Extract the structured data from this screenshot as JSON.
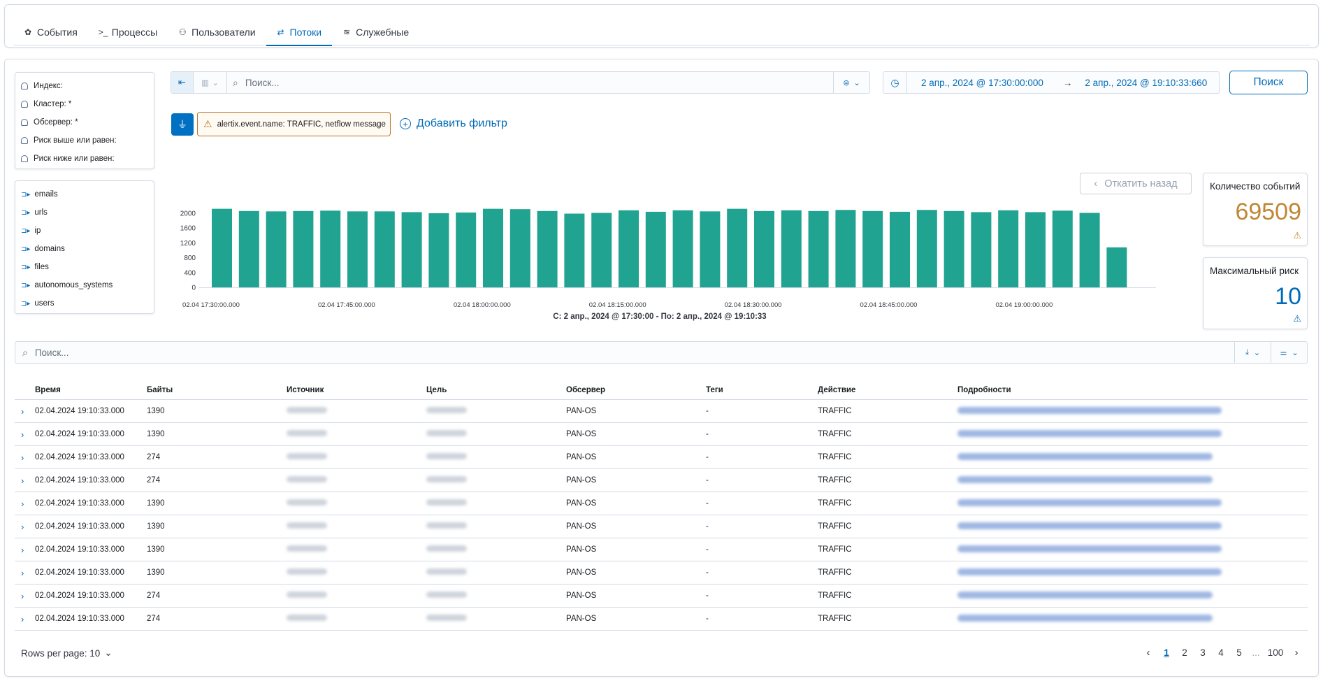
{
  "tabs": [
    {
      "label": "События",
      "icon": "events-icon",
      "glyph": "✿"
    },
    {
      "label": "Процессы",
      "icon": "terminal-icon",
      "glyph": ">_"
    },
    {
      "label": "Пользователи",
      "icon": "users-icon",
      "glyph": "⚇"
    },
    {
      "label": "Потоки",
      "icon": "flows-icon",
      "glyph": "⇄"
    },
    {
      "label": "Служебные",
      "icon": "layers-icon",
      "glyph": "≋"
    }
  ],
  "active_tab": "Потоки",
  "sidebar": {
    "filters": [
      {
        "label": "Индекс:"
      },
      {
        "label": "Кластер: *"
      },
      {
        "label": "Обсервер: *"
      },
      {
        "label": "Риск выше или равен:"
      },
      {
        "label": "Риск ниже или равен:"
      }
    ],
    "fields": [
      {
        "label": "emails"
      },
      {
        "label": "urls"
      },
      {
        "label": "ip"
      },
      {
        "label": "domains"
      },
      {
        "label": "files"
      },
      {
        "label": "autonomous_systems"
      },
      {
        "label": "users"
      }
    ]
  },
  "query": {
    "placeholder": "Поиск...",
    "search_button": "Поиск"
  },
  "date_range": {
    "start": "2 апр., 2024 @ 17:30:00:000",
    "arrow": "→",
    "end": "2 апр., 2024 @ 19:10:33:660"
  },
  "filters": {
    "pill_label": "alertix.event.name: TRAFFIC, netflow message",
    "add_filter": "Добавить фильтр"
  },
  "undo_button": "Откатить назад",
  "stats": {
    "events_label": "Количество событий",
    "events_value": "69509",
    "max_risk_label": "Максимальный риск",
    "max_risk_value": "10"
  },
  "chart_data": {
    "type": "bar",
    "color": "#21a391",
    "caption": "С: 2 апр., 2024 @ 17:30:00 - По: 2 апр., 2024 @ 19:10:33",
    "ylim": [
      0,
      2000
    ],
    "y_ticks": [
      0,
      400,
      800,
      1200,
      1600,
      2000
    ],
    "x_tick_labels": [
      "02.04 17:30:00.000",
      "02.04 17:45:00.000",
      "02.04 18:00:00.000",
      "02.04 18:15:00.000",
      "02.04 18:30:00.000",
      "02.04 18:45:00.000",
      "02.04 19:00:00.000"
    ],
    "values": [
      2120,
      2060,
      2050,
      2060,
      2070,
      2050,
      2050,
      2030,
      2000,
      2020,
      2120,
      2110,
      2060,
      1990,
      2010,
      2080,
      2040,
      2080,
      2050,
      2120,
      2060,
      2080,
      2060,
      2090,
      2060,
      2040,
      2090,
      2060,
      2030,
      2080,
      2030,
      2070,
      2010,
      1080
    ]
  },
  "table": {
    "search_placeholder": "Поиск...",
    "columns": [
      "Время",
      "Байты",
      "Источник",
      "Цель",
      "Обсервер",
      "Теги",
      "Действие",
      "Подробности"
    ],
    "rows": [
      {
        "time": "02.04.2024 19:10:33.000",
        "bytes": "1390",
        "observer": "PAN-OS",
        "tags": "-",
        "action": "TRAFFIC"
      },
      {
        "time": "02.04.2024 19:10:33.000",
        "bytes": "1390",
        "observer": "PAN-OS",
        "tags": "-",
        "action": "TRAFFIC"
      },
      {
        "time": "02.04.2024 19:10:33.000",
        "bytes": "274",
        "observer": "PAN-OS",
        "tags": "-",
        "action": "TRAFFIC"
      },
      {
        "time": "02.04.2024 19:10:33.000",
        "bytes": "274",
        "observer": "PAN-OS",
        "tags": "-",
        "action": "TRAFFIC"
      },
      {
        "time": "02.04.2024 19:10:33.000",
        "bytes": "1390",
        "observer": "PAN-OS",
        "tags": "-",
        "action": "TRAFFIC"
      },
      {
        "time": "02.04.2024 19:10:33.000",
        "bytes": "1390",
        "observer": "PAN-OS",
        "tags": "-",
        "action": "TRAFFIC"
      },
      {
        "time": "02.04.2024 19:10:33.000",
        "bytes": "1390",
        "observer": "PAN-OS",
        "tags": "-",
        "action": "TRAFFIC"
      },
      {
        "time": "02.04.2024 19:10:33.000",
        "bytes": "1390",
        "observer": "PAN-OS",
        "tags": "-",
        "action": "TRAFFIC"
      },
      {
        "time": "02.04.2024 19:10:33.000",
        "bytes": "274",
        "observer": "PAN-OS",
        "tags": "-",
        "action": "TRAFFIC"
      },
      {
        "time": "02.04.2024 19:10:33.000",
        "bytes": "274",
        "observer": "PAN-OS",
        "tags": "-",
        "action": "TRAFFIC"
      }
    ]
  },
  "footer": {
    "rows_per_page": "Rows per page: 10",
    "pages": [
      "1",
      "2",
      "3",
      "4",
      "5"
    ],
    "ellipsis": "...",
    "last_page": "100",
    "current_page": "1"
  }
}
